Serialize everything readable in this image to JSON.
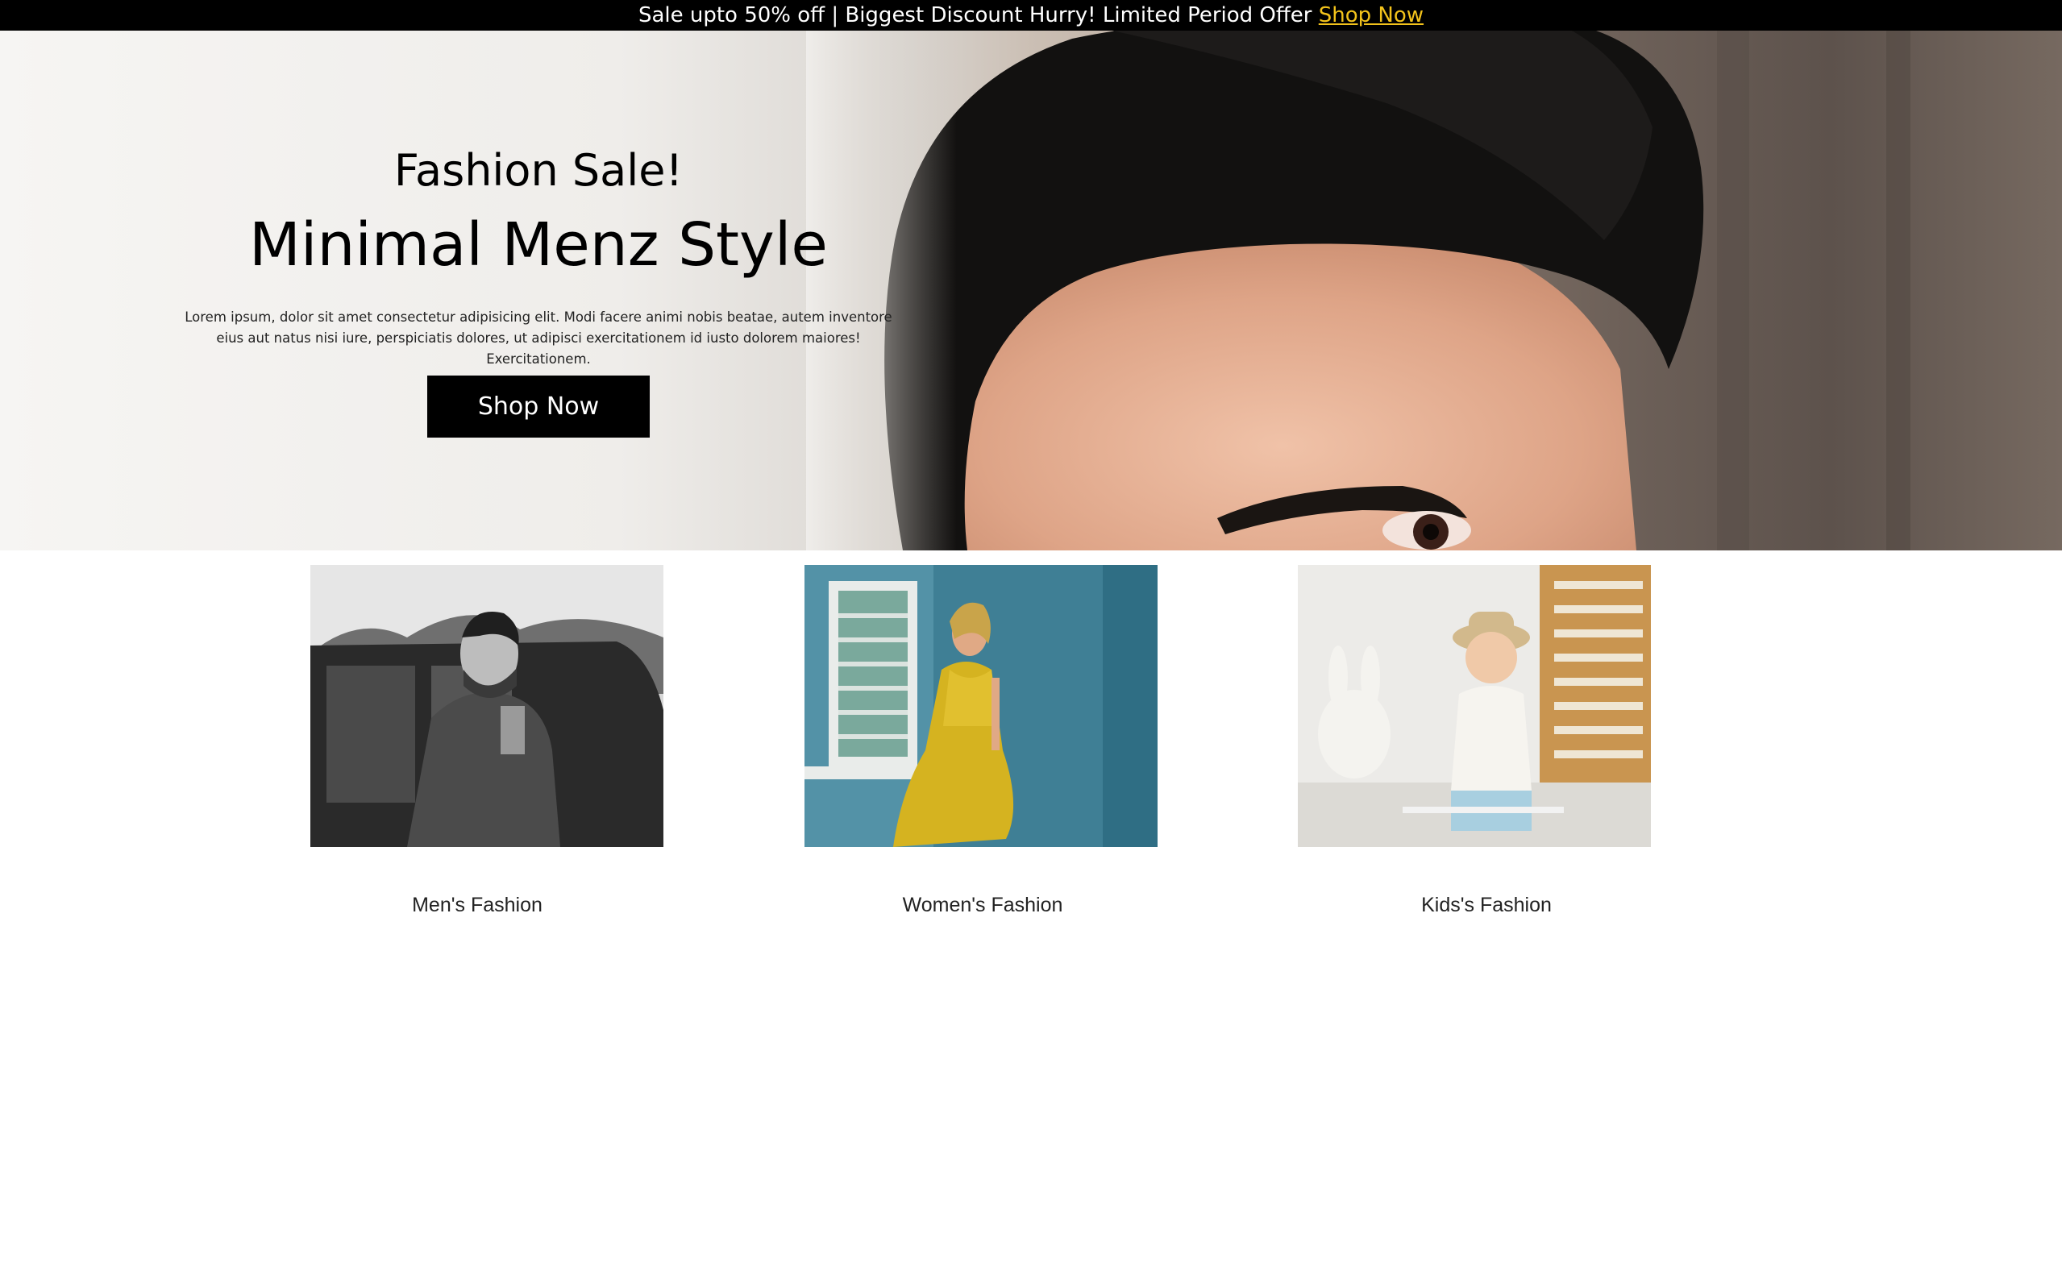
{
  "announcement": {
    "text": "Sale upto 50% off | Biggest Discount Hurry! Limited Period Offer ",
    "link_label": "Shop Now",
    "link_color": "#f2c21b"
  },
  "hero": {
    "eyebrow": "Fashion Sale!",
    "title": "Minimal Menz Style",
    "description": "Lorem ipsum, dolor sit amet consectetur adipisicing elit. Modi facere animi nobis beatae, autem inventore eius aut natus nisi iure, perspiciatis dolores, ut adipisci exercitationem id iusto dolorem maiores! Exercitationem.",
    "button_label": "Shop Now",
    "image": "man-hair-closeup-photo"
  },
  "categories": [
    {
      "label": "Men's Fashion",
      "image": "man-in-suit-photo"
    },
    {
      "label": "Women's Fashion",
      "image": "woman-yellow-dress-photo"
    },
    {
      "label": "Kids's Fashion",
      "image": "boy-with-hat-photo"
    }
  ],
  "colors": {
    "topbar_bg": "#000000",
    "button_bg": "#000000",
    "text": "#000000"
  }
}
